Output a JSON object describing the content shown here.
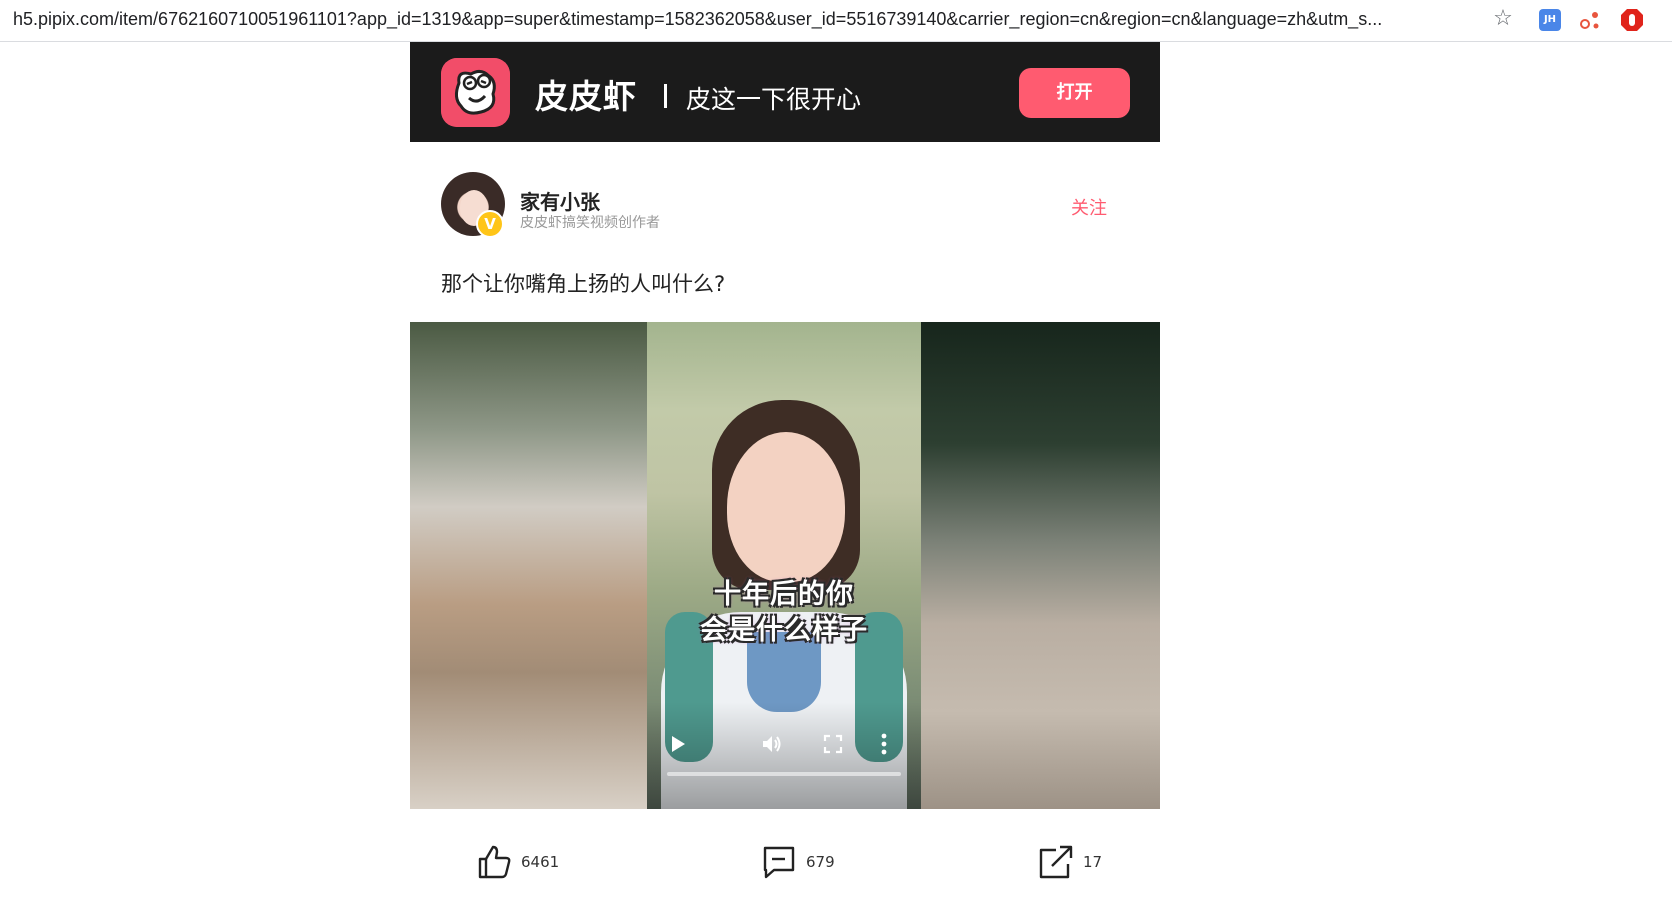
{
  "browser": {
    "url": "h5.pipix.com/item/6762160710051961101?app_id=1319&app=super&timestamp=1582362058&user_id=5516739140&carrier_region=cn&region=cn&language=zh&utm_s...",
    "extension_jh_label": "JH",
    "icons": [
      "star-icon",
      "jh-extension-icon",
      "share-extension-icon",
      "stop-extension-icon"
    ]
  },
  "banner": {
    "app_name": "皮皮虾",
    "slogan": "皮这一下很开心",
    "open_label": "打开",
    "logo_icon": "pipixia-logo-icon",
    "accent_color": "#ff5b70"
  },
  "author": {
    "name": "家有小张",
    "title": "皮皮虾搞笑视频创作者",
    "verified_badge": "V",
    "follow_label": "关注"
  },
  "post": {
    "title": "那个让你嘴角上扬的人叫什么?"
  },
  "video": {
    "subtitle_line1": "十年后的你",
    "subtitle_line2": "会是什么样子",
    "progress": 0,
    "icons": [
      "play-icon",
      "volume-icon",
      "fullscreen-icon",
      "more-icon"
    ]
  },
  "actions": {
    "likes": "6461",
    "comments": "679",
    "shares": "17",
    "icons": [
      "thumbs-up-icon",
      "comment-icon",
      "share-icon"
    ]
  }
}
